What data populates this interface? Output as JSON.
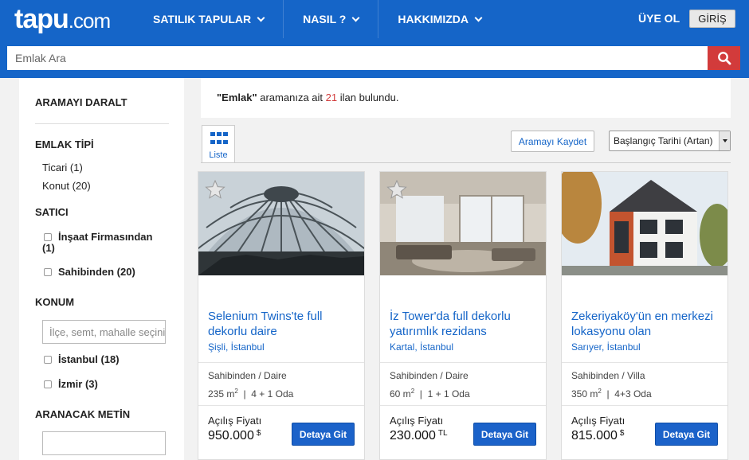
{
  "header": {
    "logo_main": "tapu",
    "logo_sub": ".com",
    "nav": [
      {
        "label": "SATILIK TAPULAR"
      },
      {
        "label": "NASIL ?"
      },
      {
        "label": "HAKKIMIZDA"
      }
    ],
    "signup_label": "ÜYE OL",
    "login_label": "GİRİŞ"
  },
  "search": {
    "placeholder": "Emlak Ara",
    "icon": "search-icon"
  },
  "sidebar": {
    "title": "ARAMAYI DARALT",
    "type_title": "EMLAK TİPİ",
    "types": [
      {
        "label": "Ticari (1)"
      },
      {
        "label": "Konut (20)"
      }
    ],
    "seller_title": "SATICI",
    "sellers": [
      {
        "label_line1": "İnşaat Firmasından",
        "label_line2": "(1)"
      },
      {
        "label": "Sahibinden (20)"
      }
    ],
    "location_title": "KONUM",
    "location_placeholder": "İlçe, semt, mahalle seçiniz",
    "locations": [
      {
        "label": "İstanbul (18)"
      },
      {
        "label": "İzmir (3)"
      }
    ],
    "text_title": "ARANACAK METİN"
  },
  "results": {
    "query": "\"Emlak\"",
    "text_mid": " aramanıza ait ",
    "count": "21",
    "text_end": " ilan bulundu."
  },
  "toolbar": {
    "list_label": "Liste",
    "save_label": "Aramayı Kaydet",
    "sort_label": "Başlangıç Tarihi (Artan)"
  },
  "listings": [
    {
      "title": "Selenium Twins'te full dekorlu daire",
      "location": "Şişli, İstanbul",
      "seller_type": "Sahibinden / Daire",
      "area": "235 m",
      "area_unit": "2",
      "rooms": "4 + 1 Oda",
      "price_label": "Açılış Fiyatı",
      "price": "950.000",
      "currency": "$",
      "detail_label": "Detaya Git"
    },
    {
      "title": "İz Tower'da full dekorlu yatırımlık rezidans",
      "location": "Kartal, İstanbul",
      "seller_type": "Sahibinden / Daire",
      "area": "60 m",
      "area_unit": "2",
      "rooms": "1 + 1 Oda",
      "price_label": "Açılış Fiyatı",
      "price": "230.000",
      "currency": "TL",
      "detail_label": "Detaya Git"
    },
    {
      "title": "Zekeriyaköy'ün en merkezi lokasyonu olan",
      "location": "Sarıyer, İstanbul",
      "seller_type": "Sahibinden / Villa",
      "area": "350 m",
      "area_unit": "2",
      "rooms": "4+3 Oda",
      "price_label": "Açılış Fiyatı",
      "price": "815.000",
      "currency": "$",
      "detail_label": "Detaya Git"
    }
  ],
  "colors": {
    "brand_blue": "#1565c8",
    "accent_red": "#d23b3b",
    "button_blue": "#1b62c9"
  }
}
